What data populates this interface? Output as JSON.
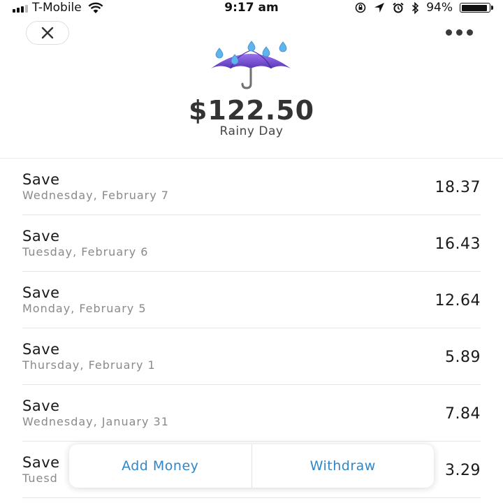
{
  "status_bar": {
    "carrier": "T-Mobile",
    "time": "9:17 am",
    "battery_percent": "94%",
    "battery_level": 0.94,
    "icons": [
      "signal-icon",
      "wifi-icon",
      "orientation-lock-icon",
      "location-icon",
      "alarm-icon",
      "bluetooth-icon",
      "battery-icon"
    ]
  },
  "header": {
    "close_icon": "close-icon",
    "more_icon": "more-icon",
    "goal_icon": "umbrella-with-raindrops-icon",
    "balance": "$122.50",
    "goal_name": "Rainy Day"
  },
  "transactions": [
    {
      "title": "Save",
      "date": "Wednesday, February 7",
      "amount": "18.37"
    },
    {
      "title": "Save",
      "date": "Tuesday, February 6",
      "amount": "16.43"
    },
    {
      "title": "Save",
      "date": "Monday, February 5",
      "amount": "12.64"
    },
    {
      "title": "Save",
      "date": "Thursday, February 1",
      "amount": "5.89"
    },
    {
      "title": "Save",
      "date": "Wednesday, January 31",
      "amount": "7.84"
    },
    {
      "title": "Save",
      "date": "Tuesd",
      "amount": "3.29"
    }
  ],
  "actions": {
    "add_money": "Add Money",
    "withdraw": "Withdraw"
  },
  "colors": {
    "accent": "#2f86c9",
    "umbrella": "#7a4fd6",
    "raindrop": "#5fb4ee",
    "secondary_text": "#8a8a8a"
  }
}
